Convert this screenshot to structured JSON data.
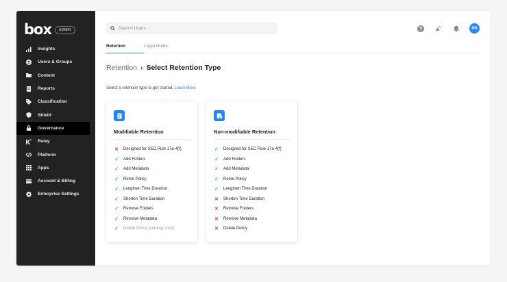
{
  "brand": {
    "logo": "box",
    "badge": "ADMIN"
  },
  "sidebar": {
    "items": [
      {
        "label": "Insights",
        "icon": "bar-chart-icon"
      },
      {
        "label": "Users & Groups",
        "icon": "users-icon"
      },
      {
        "label": "Content",
        "icon": "folder-icon"
      },
      {
        "label": "Reports",
        "icon": "report-icon"
      },
      {
        "label": "Classification",
        "icon": "tag-icon"
      },
      {
        "label": "Shield",
        "icon": "shield-icon"
      },
      {
        "label": "Governance",
        "icon": "lock-icon",
        "active": true
      },
      {
        "label": "Relay",
        "icon": "relay-icon"
      },
      {
        "label": "Platform",
        "icon": "code-icon"
      },
      {
        "label": "Apps",
        "icon": "grid-icon"
      },
      {
        "label": "Account & Billing",
        "icon": "card-icon"
      },
      {
        "label": "Enterprise Settings",
        "icon": "gear-icon"
      }
    ]
  },
  "search": {
    "placeholder": "Search Users"
  },
  "topbar": {
    "avatar_initials": "PR"
  },
  "tabs": [
    {
      "label": "Retenion",
      "active": true
    },
    {
      "label": "Legal Holds",
      "active": false
    }
  ],
  "breadcrumb": {
    "parent": "Retention",
    "separator": "›",
    "title": "Select Retention Type"
  },
  "intro": {
    "text": "Select a retention type to get started.",
    "link": "Learn More"
  },
  "colors": {
    "accent": "#2486fc",
    "sidebar": "#222222",
    "ok": "#26c281",
    "no": "#e0314b"
  },
  "cards": [
    {
      "title": "Modifiable Retention",
      "features": [
        {
          "label": "Designed for SEC Rule 17a-4(f)",
          "status": "no"
        },
        {
          "label": "Add Folders",
          "status": "ok"
        },
        {
          "label": "Add Metadata",
          "status": "ok"
        },
        {
          "label": "Retire Policy",
          "status": "ok"
        },
        {
          "label": "Lengthen Time Duration",
          "status": "ok"
        },
        {
          "label": "Shorten Time Duration",
          "status": "ok"
        },
        {
          "label": "Remove Folders",
          "status": "ok"
        },
        {
          "label": "Remove Metadata",
          "status": "ok"
        },
        {
          "label": "Delete Policy (coming soon)",
          "status": "ok",
          "muted": true
        }
      ]
    },
    {
      "title": "Non-modifiable Retention",
      "features": [
        {
          "label": "Designed for SEC Rule 17a-4(f)",
          "status": "ok"
        },
        {
          "label": "Add Folders",
          "status": "ok"
        },
        {
          "label": "Add Metadata",
          "status": "ok"
        },
        {
          "label": "Retire Policy",
          "status": "ok"
        },
        {
          "label": "Lengthen Time Duration",
          "status": "ok"
        },
        {
          "label": "Shorten Time Duration",
          "status": "no"
        },
        {
          "label": "Remove Folders",
          "status": "no"
        },
        {
          "label": "Remove Metadata",
          "status": "no"
        },
        {
          "label": "Delete Policy",
          "status": "no"
        }
      ]
    }
  ]
}
